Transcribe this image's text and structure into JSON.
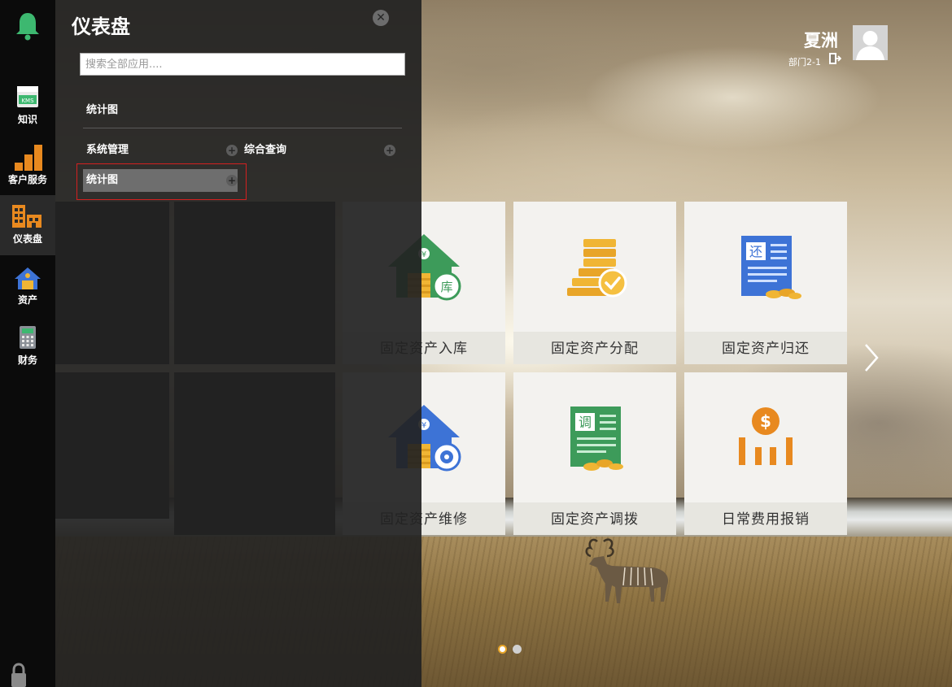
{
  "nav": {
    "items": [
      {
        "label": "",
        "icon": "bell-icon"
      },
      {
        "label": "知识",
        "icon": "kms-icon",
        "badge": "KMS"
      },
      {
        "label": "客户服务",
        "icon": "bar-chart-icon"
      },
      {
        "label": "仪表盘",
        "icon": "buildings-icon",
        "active": true
      },
      {
        "label": "资产",
        "icon": "house-icon"
      },
      {
        "label": "财务",
        "icon": "calculator-icon"
      }
    ],
    "lock_icon": "lock-icon"
  },
  "panel": {
    "title": "仪表盘",
    "search_placeholder": "搜索全部应用....",
    "section_title": "统计图",
    "menu": [
      {
        "label": "系统管理"
      },
      {
        "label": "综合查询"
      },
      {
        "label": "统计图",
        "selected": true
      }
    ],
    "add_glyph": "+"
  },
  "user": {
    "name": "夏洲",
    "department": "部门2-1"
  },
  "tiles": [
    {
      "label": "固定资产入库",
      "icon": "house-yen-icon",
      "badge": "库"
    },
    {
      "label": "固定资产分配",
      "icon": "coins-check-icon"
    },
    {
      "label": "固定资产归还",
      "icon": "doc-return-icon",
      "badge": "还"
    },
    {
      "label": "固定资产维修",
      "icon": "house-gear-icon"
    },
    {
      "label": "固定资产调拨",
      "icon": "doc-transfer-icon",
      "badge": "调"
    },
    {
      "label": "日常费用报销",
      "icon": "dollar-bars-icon"
    }
  ],
  "pager": {
    "current": 1,
    "total": 2
  },
  "colors": {
    "nav_bg": "#0b0b0b",
    "panel_bg": "#222222",
    "highlight": "#d32020",
    "accent_orange": "#e8891f"
  }
}
